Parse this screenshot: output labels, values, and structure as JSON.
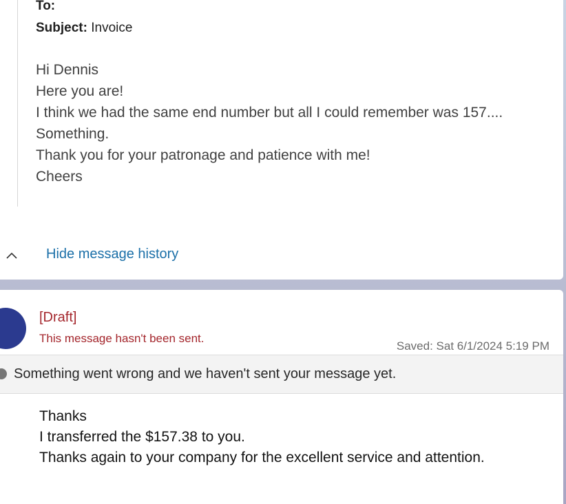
{
  "quoted": {
    "to_label": "To:",
    "subject_label": "Subject:",
    "subject_value": "Invoice",
    "lines": [
      "Hi Dennis",
      "Here you are!",
      "I think we had the same end number but all I could remember was 157....",
      "Something.",
      "Thank you for your patronage and patience with me!",
      "Cheers"
    ],
    "history_toggle_label": "Hide message history"
  },
  "draft": {
    "tag": "[Draft]",
    "note": "This message hasn't been sent.",
    "saved": "Saved: Sat 6/1/2024 5:19 PM",
    "error": "Something went wrong and we haven't sent your message yet.",
    "lines": [
      "Thanks",
      "I transferred the $157.38 to you.",
      "Thanks again to your company for the excellent service and attention."
    ]
  },
  "colors": {
    "link": "#1a6fa8",
    "draft_red": "#a4262c",
    "avatar": "#2b3a8f"
  },
  "icons": {
    "toggle": "chevron-up-icon",
    "error": "error-status-icon"
  }
}
